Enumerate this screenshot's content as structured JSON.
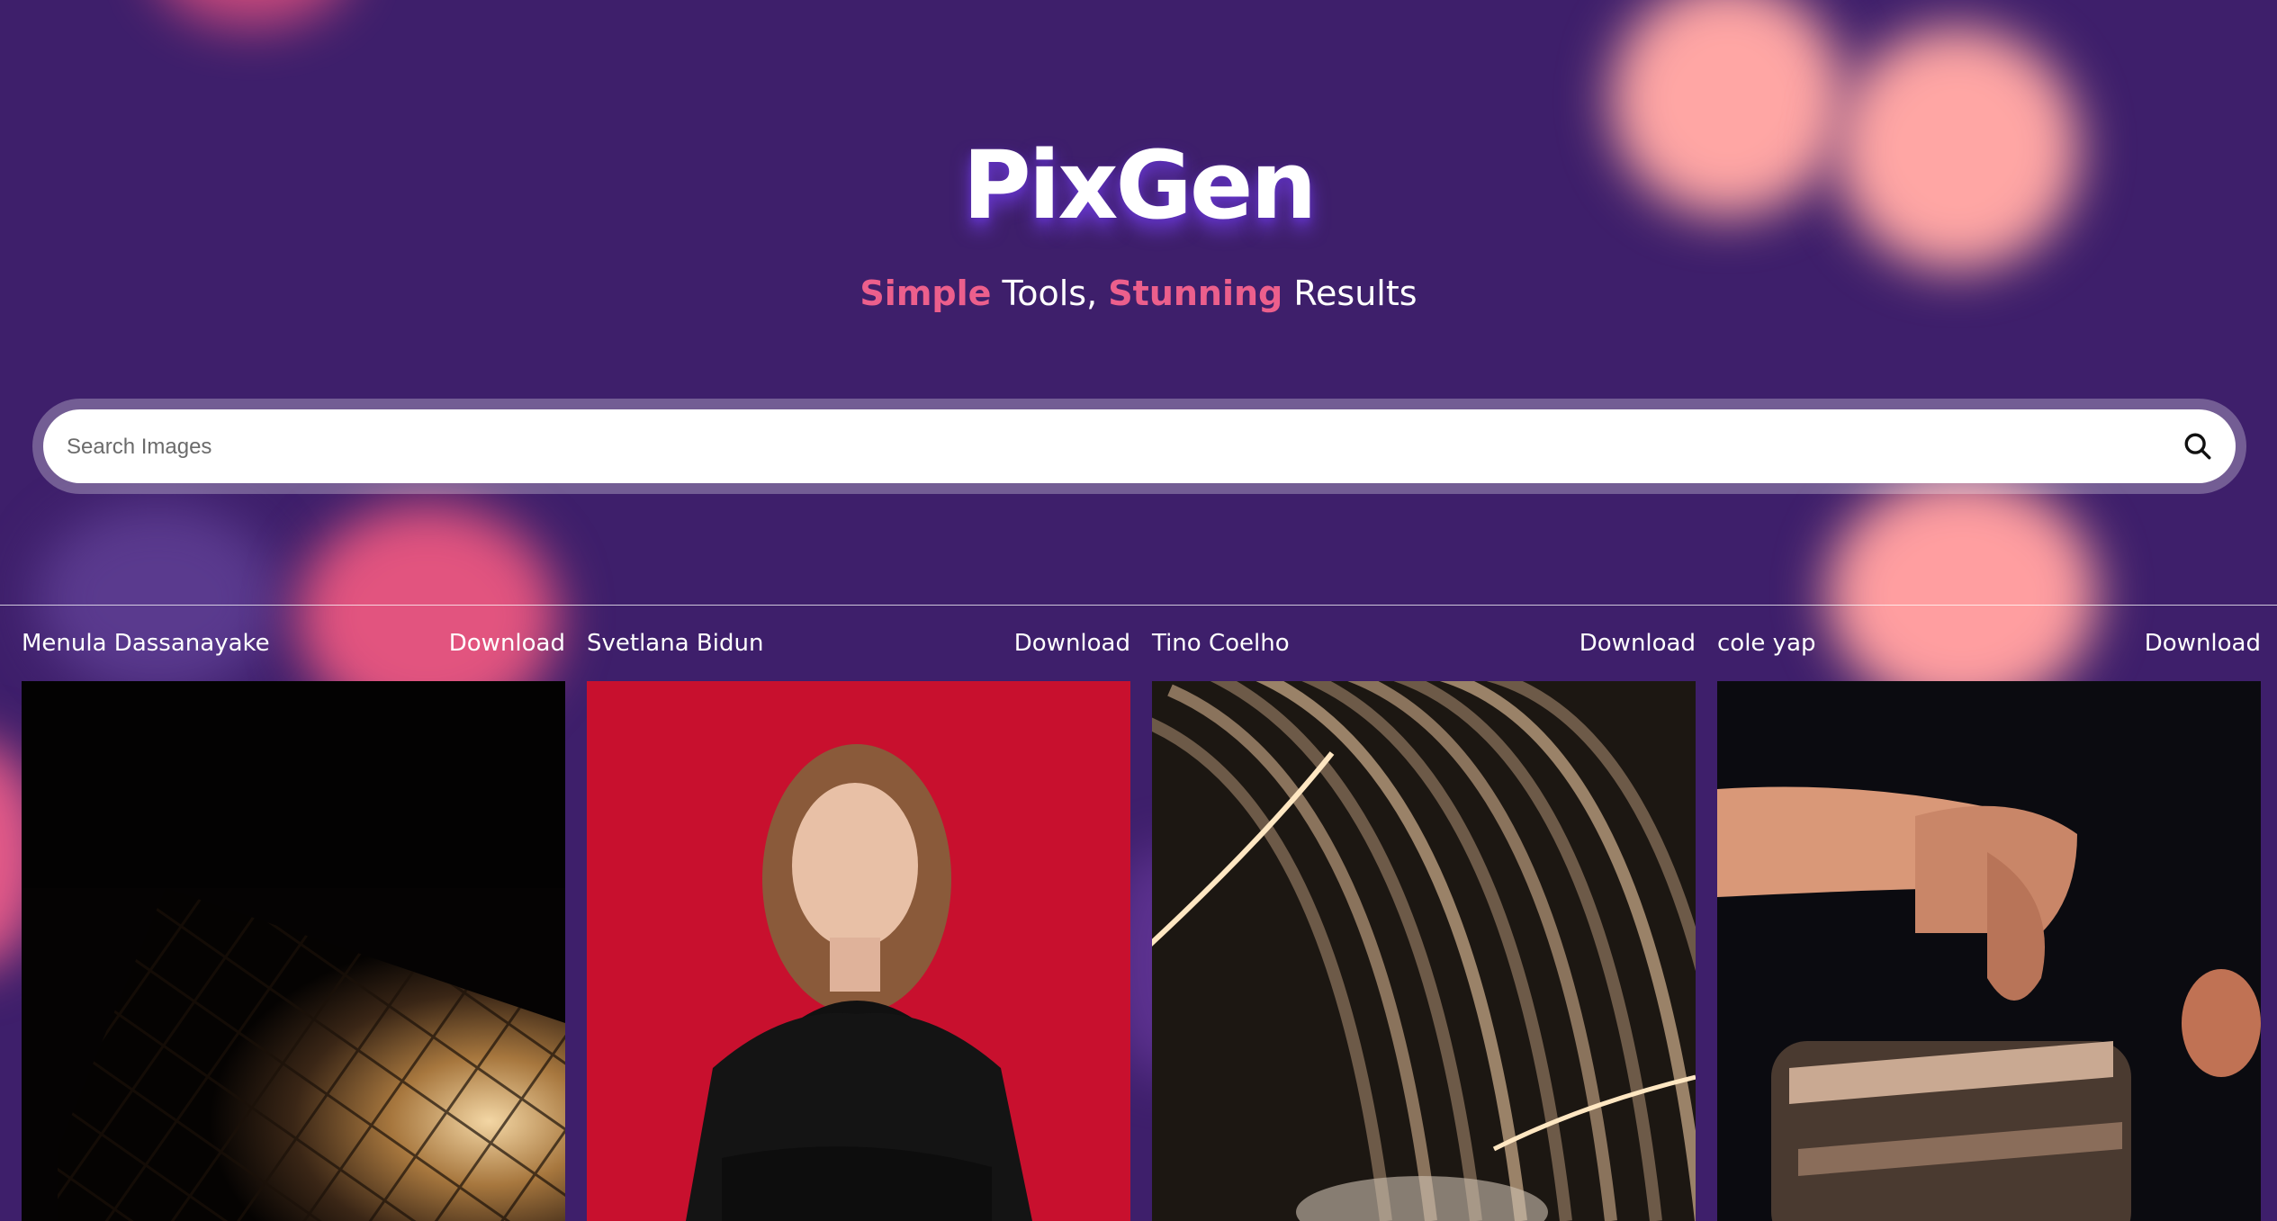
{
  "app": {
    "logo": "PixGen",
    "tagline": {
      "word1": "Simple",
      "word2": " Tools, ",
      "word3": "Stunning",
      "word4": " Results"
    },
    "colors": {
      "background": "#3e1f6b",
      "accent": "#ec5f8c",
      "glow": "#ffa6a4"
    }
  },
  "search": {
    "placeholder": "Search Images",
    "value": "",
    "icon": "search-icon"
  },
  "results": [
    {
      "author": "Menula Dassanayake",
      "download_label": "Download",
      "image": "lamp-light-photo"
    },
    {
      "author": "Svetlana Bidun",
      "download_label": "Download",
      "image": "portrait-red-background-photo"
    },
    {
      "author": "Tino Coelho",
      "download_label": "Download",
      "image": "curved-architecture-photo"
    },
    {
      "author": "cole yap",
      "download_label": "Download",
      "image": "hand-on-metal-photo"
    }
  ]
}
